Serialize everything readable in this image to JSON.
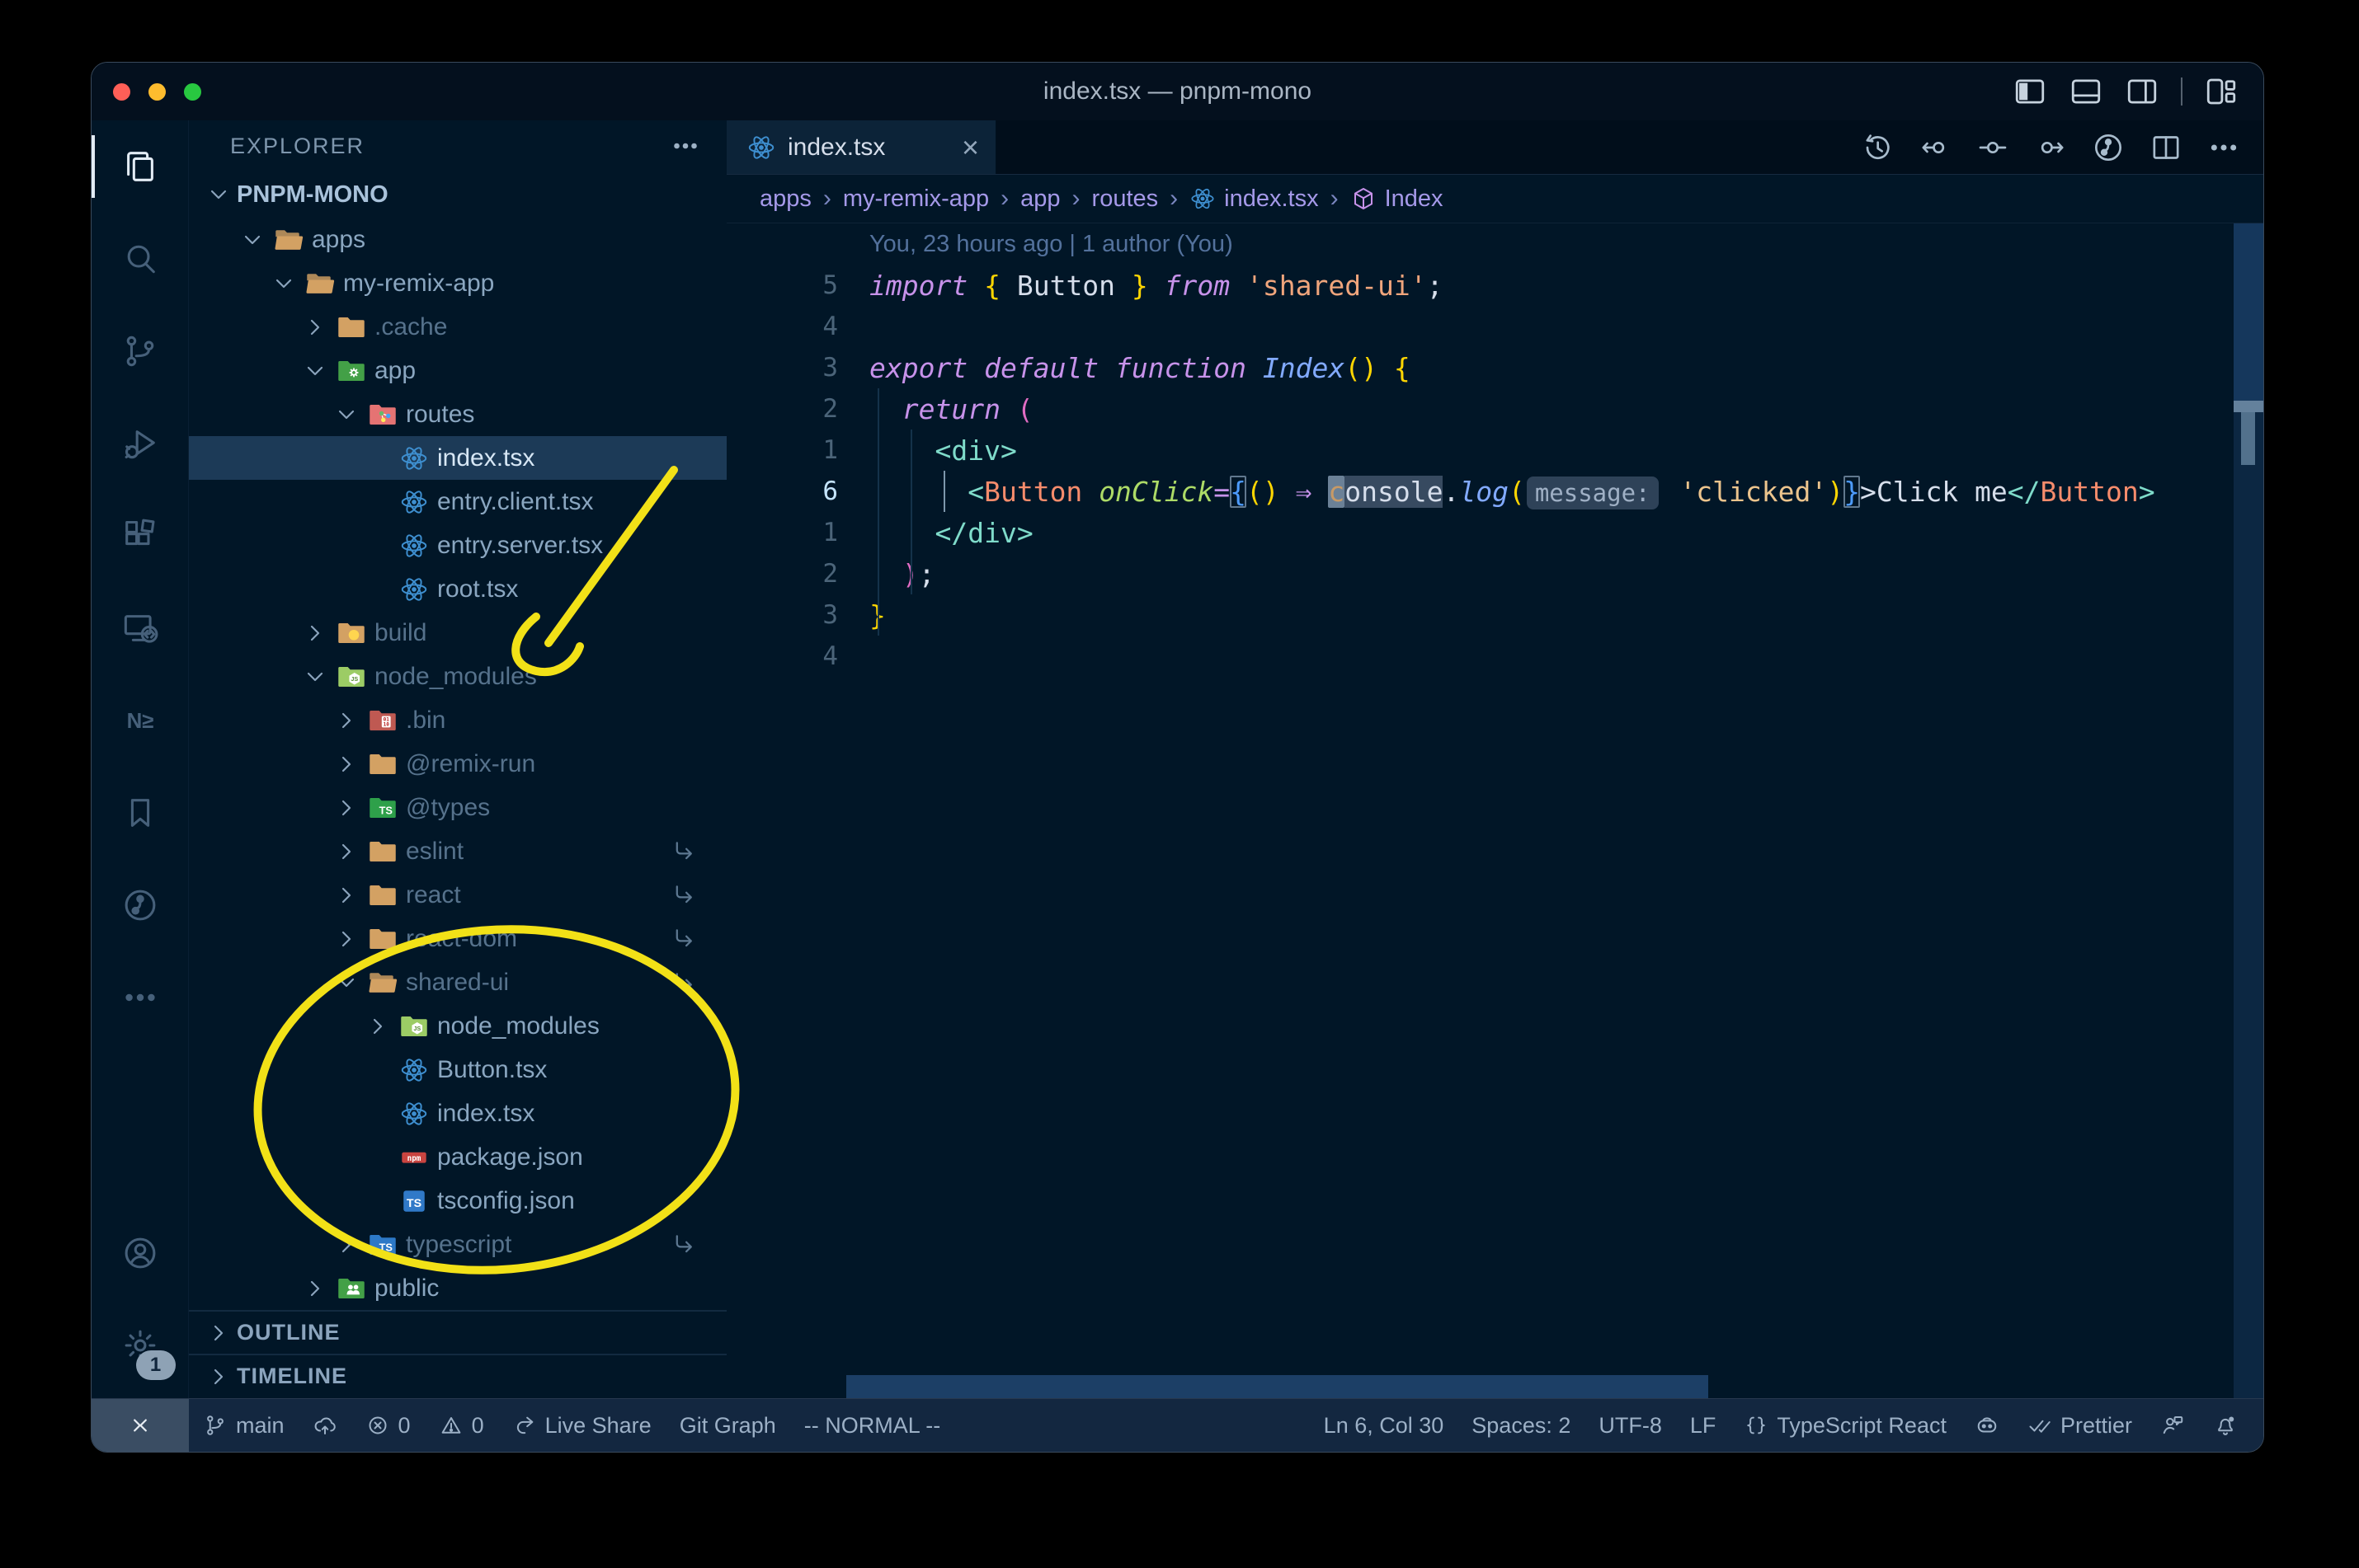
{
  "window": {
    "title": "index.tsx — pnpm-mono"
  },
  "titlebar": {
    "traffic_lights": [
      "close",
      "minimize",
      "zoom"
    ],
    "layout_icons": [
      "layout-sidebar-left",
      "layout-panel",
      "layout-sidebar-right",
      "layout-customize"
    ]
  },
  "activity_bar": {
    "items": [
      {
        "name": "explorer",
        "icon": "files",
        "active": true
      },
      {
        "name": "search",
        "icon": "search"
      },
      {
        "name": "source-control",
        "icon": "scm"
      },
      {
        "name": "run-debug",
        "icon": "debug"
      },
      {
        "name": "extensions",
        "icon": "extensions"
      },
      {
        "name": "remote-explorer",
        "icon": "remote"
      },
      {
        "name": "nx-console",
        "icon": "nx"
      },
      {
        "name": "bookmarks",
        "icon": "bookmark"
      },
      {
        "name": "gitlens",
        "icon": "gitlens"
      },
      {
        "name": "more-views",
        "icon": "ellipsis"
      }
    ],
    "bottom": [
      {
        "name": "accounts",
        "icon": "account"
      },
      {
        "name": "settings",
        "icon": "gear",
        "badge": "1"
      }
    ]
  },
  "sidebar": {
    "header": "EXPLORER",
    "project": "PNPM-MONO",
    "tree": [
      {
        "label": "apps",
        "indent": 0,
        "chevron": "down",
        "icon": "folder-open"
      },
      {
        "label": "my-remix-app",
        "indent": 1,
        "chevron": "down",
        "icon": "folder-open"
      },
      {
        "label": ".cache",
        "indent": 2,
        "chevron": "right",
        "icon": "folder",
        "dim": true
      },
      {
        "label": "app",
        "indent": 2,
        "chevron": "down",
        "icon": "folder-app"
      },
      {
        "label": "routes",
        "indent": 3,
        "chevron": "down",
        "icon": "folder-routes"
      },
      {
        "label": "index.tsx",
        "indent": 4,
        "chevron": "none",
        "icon": "react",
        "selected": true
      },
      {
        "label": "entry.client.tsx",
        "indent": 4,
        "chevron": "none",
        "icon": "react"
      },
      {
        "label": "entry.server.tsx",
        "indent": 4,
        "chevron": "none",
        "icon": "react"
      },
      {
        "label": "root.tsx",
        "indent": 4,
        "chevron": "none",
        "icon": "react"
      },
      {
        "label": "build",
        "indent": 2,
        "chevron": "right",
        "icon": "folder-build",
        "dim": true
      },
      {
        "label": "node_modules",
        "indent": 2,
        "chevron": "down",
        "icon": "folder-nm",
        "dim": true
      },
      {
        "label": ".bin",
        "indent": 3,
        "chevron": "right",
        "icon": "folder-bin",
        "dim": true
      },
      {
        "label": "@remix-run",
        "indent": 3,
        "chevron": "right",
        "icon": "folder",
        "dim": true
      },
      {
        "label": "@types",
        "indent": 3,
        "chevron": "right",
        "icon": "folder-types",
        "dim": true
      },
      {
        "label": "eslint",
        "indent": 3,
        "chevron": "right",
        "icon": "folder",
        "dim": true,
        "symlink": true
      },
      {
        "label": "react",
        "indent": 3,
        "chevron": "right",
        "icon": "folder",
        "dim": true,
        "symlink": true
      },
      {
        "label": "react-dom",
        "indent": 3,
        "chevron": "right",
        "icon": "folder",
        "dim": true,
        "symlink": true
      },
      {
        "label": "shared-ui",
        "indent": 3,
        "chevron": "down",
        "icon": "folder-open",
        "dim": true,
        "symlink": true
      },
      {
        "label": "node_modules",
        "indent": 4,
        "chevron": "right",
        "icon": "folder-nm"
      },
      {
        "label": "Button.tsx",
        "indent": 4,
        "chevron": "none",
        "icon": "react"
      },
      {
        "label": "index.tsx",
        "indent": 4,
        "chevron": "none",
        "icon": "react"
      },
      {
        "label": "package.json",
        "indent": 4,
        "chevron": "none",
        "icon": "npm"
      },
      {
        "label": "tsconfig.json",
        "indent": 4,
        "chevron": "none",
        "icon": "ts"
      },
      {
        "label": "typescript",
        "indent": 3,
        "chevron": "right",
        "icon": "folder-ts",
        "dim": true,
        "symlink": true
      },
      {
        "label": "public",
        "indent": 2,
        "chevron": "right",
        "icon": "folder-public"
      }
    ],
    "sections": [
      {
        "label": "OUTLINE"
      },
      {
        "label": "TIMELINE"
      }
    ]
  },
  "editor": {
    "tab": {
      "label": "index.tsx",
      "icon": "react",
      "close": "×"
    },
    "actions": [
      "history",
      "prev-change",
      "change",
      "next-change",
      "gitlens",
      "split",
      "kebab"
    ],
    "breadcrumbs": [
      {
        "label": "apps"
      },
      {
        "label": "my-remix-app"
      },
      {
        "label": "app"
      },
      {
        "label": "routes"
      },
      {
        "label": "index.tsx",
        "icon": "react"
      },
      {
        "label": "Index",
        "icon": "symbol-module"
      }
    ],
    "blame": "You, 23 hours ago | 1 author (You)",
    "lines": [
      {
        "n": "5",
        "tokens": [
          [
            "kw",
            "import"
          ],
          [
            "pl",
            " "
          ],
          [
            "bry",
            "{"
          ],
          [
            "pl",
            " Button "
          ],
          [
            "bry",
            "}"
          ],
          [
            "pl",
            " "
          ],
          [
            "kw",
            "from"
          ],
          [
            "pl",
            " "
          ],
          [
            "str2",
            "'shared-ui'"
          ],
          [
            "pl",
            ";"
          ]
        ]
      },
      {
        "n": "4",
        "tokens": []
      },
      {
        "n": "3",
        "tokens": [
          [
            "kw",
            "export"
          ],
          [
            "pl",
            " "
          ],
          [
            "kw",
            "default"
          ],
          [
            "pl",
            " "
          ],
          [
            "kw",
            "function"
          ],
          [
            "pl",
            " "
          ],
          [
            "fn",
            "Index"
          ],
          [
            "bry",
            "()"
          ],
          [
            "pl",
            " "
          ],
          [
            "bry",
            "{"
          ]
        ]
      },
      {
        "n": "2",
        "tokens": [
          [
            "pl",
            "  "
          ],
          [
            "kw",
            "return"
          ],
          [
            "pl",
            " "
          ],
          [
            "brp",
            "("
          ]
        ]
      },
      {
        "n": "1",
        "tokens": [
          [
            "pl",
            "    "
          ],
          [
            "tag",
            "<div>"
          ]
        ]
      },
      {
        "n": "6",
        "active": true,
        "tokens": [
          [
            "pl",
            "      "
          ],
          [
            "tag",
            "<"
          ],
          [
            "tagc",
            "Button"
          ],
          [
            "pl",
            " "
          ],
          [
            "attr",
            "onClick"
          ],
          [
            "kw",
            "="
          ],
          [
            "brb box",
            "{"
          ],
          [
            "bry",
            "()"
          ],
          [
            "pl",
            " "
          ],
          [
            "arr",
            "⇒"
          ],
          [
            "pl",
            " "
          ],
          [
            "cur",
            "c"
          ],
          [
            "whl",
            "onsole"
          ],
          [
            "pl",
            "."
          ],
          [
            "fn",
            "log"
          ],
          [
            "bry",
            "("
          ],
          [
            "inlay",
            "message:"
          ],
          [
            "pl",
            " "
          ],
          [
            "str",
            "'clicked'"
          ],
          [
            "bry",
            ")"
          ],
          [
            "brb box",
            "}"
          ],
          [
            "pl",
            ">Click me"
          ],
          [
            "tag",
            "</"
          ],
          [
            "tagc",
            "Button"
          ],
          [
            "tag",
            ">"
          ]
        ]
      },
      {
        "n": "1",
        "tokens": [
          [
            "pl",
            "    "
          ],
          [
            "tag",
            "</div>"
          ]
        ]
      },
      {
        "n": "2",
        "tokens": [
          [
            "pl",
            "  "
          ],
          [
            "brp",
            ")"
          ],
          [
            "pl",
            ";"
          ]
        ]
      },
      {
        "n": "3",
        "tokens": [
          [
            "bry",
            "}"
          ]
        ]
      },
      {
        "n": "4",
        "tokens": []
      }
    ]
  },
  "status_bar": {
    "left": [
      {
        "name": "remote",
        "icon": "remote-indicator",
        "box": true
      },
      {
        "name": "git-branch",
        "icon": "branch",
        "label": "main"
      },
      {
        "name": "sync",
        "icon": "cloud-upload"
      },
      {
        "name": "errors",
        "icon": "error",
        "label": "0"
      },
      {
        "name": "warnings",
        "icon": "warning",
        "label": "0"
      },
      {
        "name": "live-share",
        "icon": "live-share",
        "label": "Live Share"
      },
      {
        "name": "git-graph",
        "label": "Git Graph"
      },
      {
        "name": "vim-mode",
        "label": "-- NORMAL --"
      }
    ],
    "right": [
      {
        "name": "cursor-position",
        "label": "Ln 6, Col 30"
      },
      {
        "name": "indentation",
        "label": "Spaces: 2"
      },
      {
        "name": "encoding",
        "label": "UTF-8"
      },
      {
        "name": "eol",
        "label": "LF"
      },
      {
        "name": "language-mode",
        "icon": "braces",
        "label": "TypeScript React"
      },
      {
        "name": "copilot",
        "icon": "copilot"
      },
      {
        "name": "prettier",
        "icon": "double-check",
        "label": "Prettier"
      },
      {
        "name": "feedback",
        "icon": "feedback"
      },
      {
        "name": "notifications",
        "icon": "bell-dot"
      }
    ]
  },
  "annotations": {
    "color": "#f2e117",
    "arrow_target": "node_modules",
    "circle_target": "shared-ui contents"
  }
}
